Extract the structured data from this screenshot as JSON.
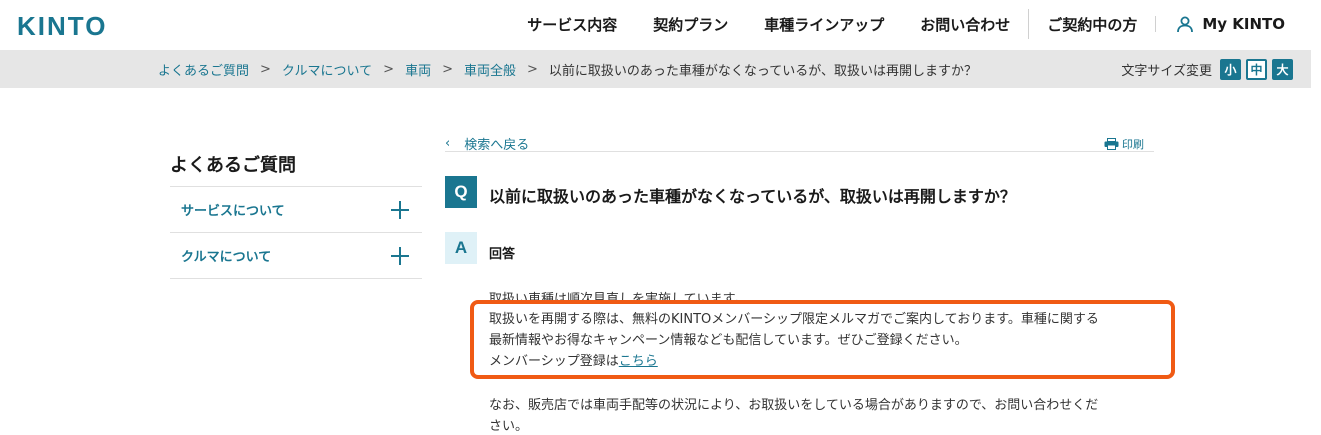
{
  "header": {
    "logo": "KINTO",
    "nav": [
      "サービス内容",
      "契約プラン",
      "車種ラインアップ",
      "お問い合わせ",
      "ご契約中の方"
    ],
    "mykinto_label": "My KINTO",
    "mykinto_icon": "user-icon"
  },
  "breadcrumb": {
    "links": [
      "よくあるご質問",
      "クルマについて",
      "車両",
      "車両全般"
    ],
    "separator": ">",
    "current": "以前に取扱いのあった車種がなくなっているが、取扱いは再開しますか？"
  },
  "font_size": {
    "label": "文字サイズ変更",
    "options": [
      "小",
      "中",
      "大"
    ],
    "selected": "小"
  },
  "sidebar": {
    "title": "よくあるご質問",
    "items": [
      {
        "label": "サービスについて",
        "icon": "plus-icon"
      },
      {
        "label": "クルマについて",
        "icon": "plus-icon"
      }
    ]
  },
  "main": {
    "back_label": "検索へ戻る",
    "print_label": "印刷",
    "question_badge": "Q",
    "question": "以前に取扱いのあった車種がなくなっているが、取扱いは再開しますか？",
    "answer_badge": "A",
    "answer_label": "回答",
    "paragraph1": "取扱い車種は順次見直しを実施しています。",
    "paragraph2_line1": "取扱いを再開する際は、無料のKINTOメンバーシップ限定メルマガでご案内しております。車種に関する",
    "paragraph2_line2": "最新情報やお得なキャンペーン情報なども配信しています。ぜひご登録ください。",
    "paragraph2_line3_prefix": "メンバーシップ登録は",
    "paragraph2_link": "こちら",
    "paragraph3_line1": "なお、販売店では車両手配等の状況により、お取扱いをしている場合がありますので、お問い合わせくだ",
    "paragraph3_line2": "さい。"
  },
  "colors": {
    "brand": "#1a7690",
    "highlight_border": "#f05a14",
    "breadcrumb_bg": "#e6e6e6"
  }
}
